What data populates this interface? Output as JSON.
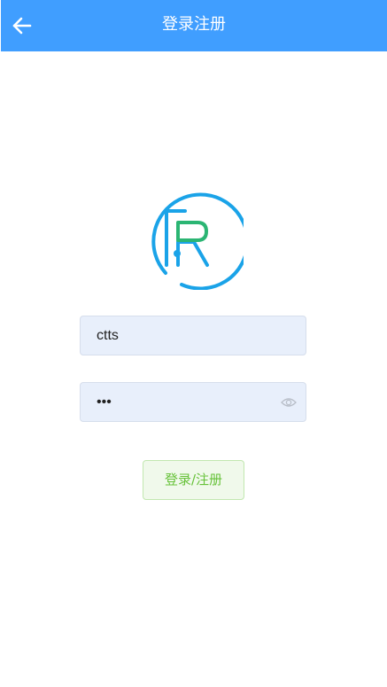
{
  "header": {
    "title": "登录注册",
    "back_icon": "arrow-left-icon"
  },
  "logo": {
    "icon": "r-logo-icon",
    "ring_color": "#1aa3e8",
    "accent_color": "#2bb573"
  },
  "form": {
    "username_value": "ctts",
    "password_value": "123",
    "password_icon": "eye-icon"
  },
  "submit": {
    "label": "登录/注册"
  },
  "colors": {
    "header_bg": "#409eff",
    "input_bg": "#e8effb",
    "button_bg": "#f0f9eb",
    "button_text": "#67c23a"
  }
}
